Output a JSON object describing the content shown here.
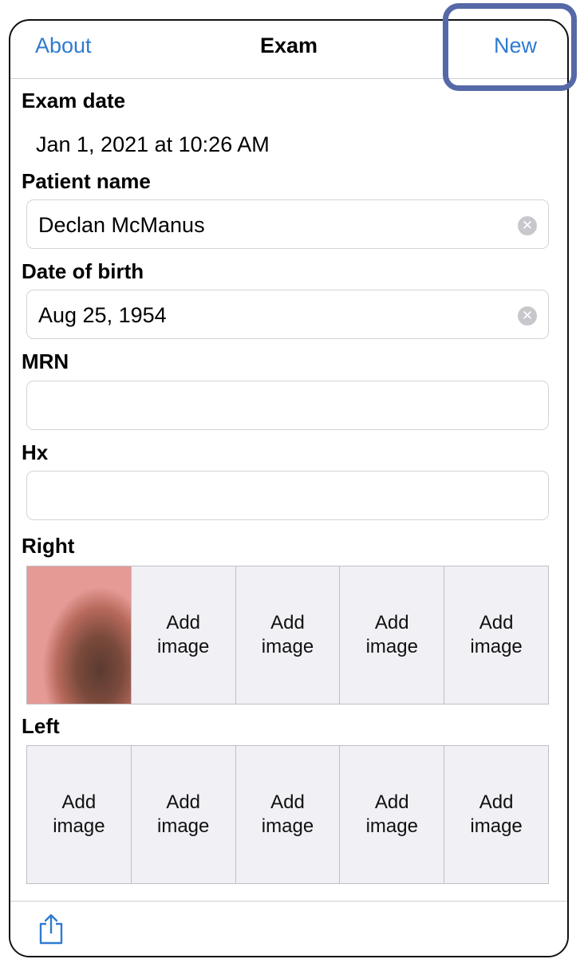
{
  "nav": {
    "left": "About",
    "title": "Exam",
    "right": "New"
  },
  "exam_date": {
    "label": "Exam date",
    "value": "Jan 1, 2021 at 10:26 AM"
  },
  "patient_name": {
    "label": "Patient name",
    "value": "Declan McManus"
  },
  "dob": {
    "label": "Date of birth",
    "value": "Aug 25, 1954"
  },
  "mrn": {
    "label": "MRN",
    "value": ""
  },
  "hx": {
    "label": "Hx",
    "value": ""
  },
  "right": {
    "label": "Right",
    "cells": [
      "",
      "Add\nimage",
      "Add\nimage",
      "Add\nimage",
      "Add\nimage"
    ]
  },
  "left": {
    "label": "Left",
    "cells": [
      "Add\nimage",
      "Add\nimage",
      "Add\nimage",
      "Add\nimage",
      "Add\nimage"
    ]
  },
  "colors": {
    "accent": "#2f7bd1",
    "highlight": "#5568a8"
  },
  "icons": {
    "clear": "clear-icon",
    "share": "share-icon"
  }
}
